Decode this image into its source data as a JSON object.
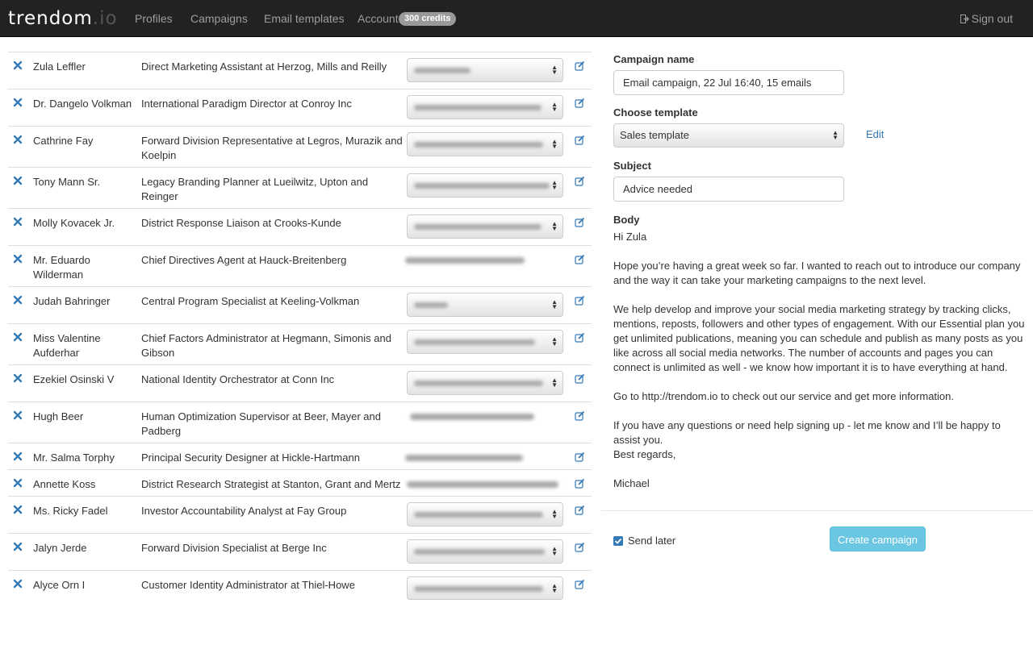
{
  "navbar": {
    "brand_main": "trendom",
    "brand_tld": ".io",
    "links": {
      "profiles": "Profiles",
      "campaigns": "Campaigns",
      "email_templates": "Email templates",
      "account": "Account"
    },
    "credits_badge": "300 credits",
    "sign_out": "Sign out"
  },
  "profiles": [
    {
      "name": "Zula Leffler",
      "title": "Direct Marketing Assistant at Herzog, Mills and Reilly"
    },
    {
      "name": "Dr. Dangelo Volkman",
      "title": "International Paradigm Director at Conroy Inc"
    },
    {
      "name": "Cathrine Fay",
      "title": "Forward Division Representative at Legros, Murazik and Koelpin"
    },
    {
      "name": "Tony Mann Sr.",
      "title": "Legacy Branding Planner at Lueilwitz, Upton and Reinger"
    },
    {
      "name": "Molly Kovacek Jr.",
      "title": "District Response Liaison at Crooks-Kunde"
    },
    {
      "name": "Mr. Eduardo Wilderman",
      "title": "Chief Directives Agent at Hauck-Breitenberg"
    },
    {
      "name": "Judah Bahringer",
      "title": "Central Program Specialist at Keeling-Volkman"
    },
    {
      "name": "Miss Valentine Aufderhar",
      "title": "Chief Factors Administrator at Hegmann, Simonis and Gibson"
    },
    {
      "name": "Ezekiel Osinski V",
      "title": "National Identity Orchestrator at Conn Inc"
    },
    {
      "name": "Hugh Beer",
      "title": "Human Optimization Supervisor at Beer, Mayer and Padberg"
    },
    {
      "name": "Mr. Salma Torphy",
      "title": "Principal Security Designer at Hickle-Hartmann"
    },
    {
      "name": "Annette Koss",
      "title": "District Research Strategist at Stanton, Grant and Mertz"
    },
    {
      "name": "Ms. Ricky Fadel",
      "title": "Investor Accountability Analyst at Fay Group"
    },
    {
      "name": "Jalyn Jerde",
      "title": "Forward Division Specialist at Berge Inc"
    },
    {
      "name": "Alyce Orn I",
      "title": "Customer Identity Administrator at Thiel-Howe"
    }
  ],
  "campaign": {
    "name_label": "Campaign name",
    "name_value": "Email campaign, 22 Jul 16:40, 15 emails",
    "template_label": "Choose template",
    "template_value": "Sales template",
    "edit_link": "Edit",
    "subject_label": "Subject",
    "subject_value": "Advice needed",
    "body_label": "Body",
    "body_greeting": "Hi Zula",
    "body_p1": "Hope you’re having a great week so far. I wanted to reach out to introduce our company and the way it can take your marketing campaigns to the next level.",
    "body_p2": "We help develop and improve your social media marketing strategy by tracking clicks, mentions, reposts, followers and other types of engagement. With our Essential plan you get unlimited publications, meaning you can schedule and publish as many posts as you like across all social media networks. The number of accounts and pages you can connect is unlimited as well - we know how important it is to have everything at hand.",
    "body_p3": "Go to http://trendom.io to check out our service and get more information.",
    "body_p4": "If you have any questions or need help signing up - let me know and I’ll be happy to assist you.",
    "body_regards": "Best regards,",
    "body_signature": "Michael",
    "send_later_label": "Send later",
    "send_later_checked": true,
    "create_button": "Create campaign"
  },
  "colors": {
    "navbar_bg": "#222222",
    "link_blue": "#337ab7",
    "button_info": "#5bc0de"
  }
}
